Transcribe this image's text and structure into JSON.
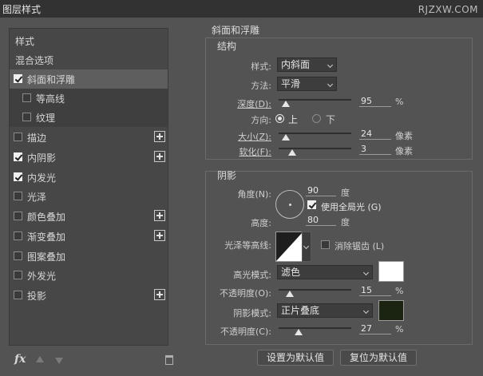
{
  "window": {
    "title": "图层样式",
    "watermark": "RJZXW.COM"
  },
  "left_panel": {
    "items": [
      {
        "label": "样式"
      },
      {
        "label": "混合选项"
      },
      {
        "label": "斜面和浮雕",
        "checked": true,
        "active": true
      },
      {
        "label": "等高线",
        "checked": false
      },
      {
        "label": "纹理",
        "checked": false
      },
      {
        "label": "描边",
        "checked": false,
        "plus": true
      },
      {
        "label": "内阴影",
        "checked": true,
        "plus": true
      },
      {
        "label": "内发光",
        "checked": true
      },
      {
        "label": "光泽",
        "checked": false
      },
      {
        "label": "颜色叠加",
        "checked": false,
        "plus": true
      },
      {
        "label": "渐变叠加",
        "checked": false,
        "plus": true
      },
      {
        "label": "图案叠加",
        "checked": false
      },
      {
        "label": "外发光",
        "checked": false
      },
      {
        "label": "投影",
        "checked": false,
        "plus": true
      }
    ],
    "footer": {
      "fx_label": "fx"
    }
  },
  "bevel": {
    "title": "斜面和浮雕",
    "structure": {
      "title": "结构",
      "style_label": "样式:",
      "style_value": "内斜面",
      "technique_label": "方法:",
      "technique_value": "平滑",
      "depth_label": "深度(D):",
      "depth_value": "95",
      "depth_unit": "%",
      "depth_fraction": 0.095,
      "direction_label": "方向:",
      "direction_up": "上",
      "direction_down": "下",
      "size_label": "大小(Z):",
      "size_value": "24",
      "size_unit": "像素",
      "size_fraction": 0.095,
      "soften_label": "软化(F):",
      "soften_value": "3",
      "soften_unit": "像素",
      "soften_fraction": 0.19
    },
    "shading": {
      "title": "阴影",
      "angle_label": "角度(N):",
      "angle_value": "90",
      "angle_unit": "度",
      "global_light_label": "使用全局光 (G)",
      "global_light_checked": true,
      "altitude_label": "高度:",
      "altitude_value": "80",
      "altitude_unit": "度",
      "gloss_contour_label": "光泽等高线:",
      "anti_alias_label": "消除锯齿 (L)",
      "anti_alias_checked": false,
      "highlight_mode_label": "高光模式:",
      "highlight_mode_value": "滤色",
      "highlight_color": "#ffffff",
      "highlight_opacity_label": "不透明度(O):",
      "highlight_opacity_value": "15",
      "highlight_opacity_unit": "%",
      "highlight_opacity_fraction": 0.15,
      "shadow_mode_label": "阴影模式:",
      "shadow_mode_value": "正片叠底",
      "shadow_color": "#1a2410",
      "shadow_opacity_label": "不透明度(C):",
      "shadow_opacity_value": "27",
      "shadow_opacity_unit": "%",
      "shadow_opacity_fraction": 0.27
    },
    "buttons": {
      "make_default": "设置为默认值",
      "reset_default": "复位为默认值"
    }
  }
}
